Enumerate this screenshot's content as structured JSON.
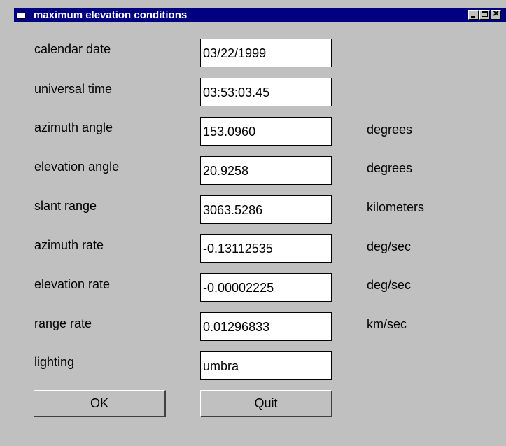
{
  "window": {
    "title": "maximum elevation conditions"
  },
  "rows": [
    {
      "label": "calendar date",
      "value": "03/22/1999",
      "unit": ""
    },
    {
      "label": "universal time",
      "value": "03:53:03.45",
      "unit": ""
    },
    {
      "label": "azimuth angle",
      "value": "153.0960",
      "unit": "degrees"
    },
    {
      "label": "elevation angle",
      "value": "20.9258",
      "unit": "degrees"
    },
    {
      "label": "slant range",
      "value": "3063.5286",
      "unit": "kilometers"
    },
    {
      "label": "azimuth rate",
      "value": "-0.13112535",
      "unit": "deg/sec"
    },
    {
      "label": "elevation rate",
      "value": "-0.00002225",
      "unit": "deg/sec"
    },
    {
      "label": "range rate",
      "value": "0.01296833",
      "unit": "km/sec"
    },
    {
      "label": "lighting",
      "value": "umbra",
      "unit": ""
    }
  ],
  "buttons": {
    "ok_label": "OK",
    "quit_label": "Quit"
  },
  "icons": {
    "window_icon": "window-icon",
    "minimize": "minimize-icon",
    "maximize": "maximize-icon",
    "close": "close-icon"
  },
  "colors": {
    "titlebar": "#000080",
    "background": "#c0c0c0",
    "field": "#ffffff"
  }
}
